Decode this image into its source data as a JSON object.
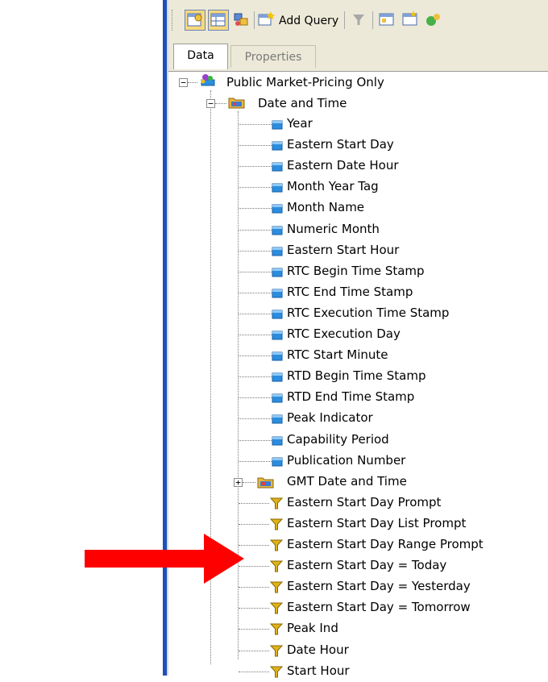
{
  "toolbar": {
    "add_query_label": "Add Query"
  },
  "tabs": [
    {
      "label": "Data",
      "active": true
    },
    {
      "label": "Properties",
      "active": false
    }
  ],
  "tree": {
    "root": {
      "label": "Public Market-Pricing Only",
      "expanded": true
    },
    "folder": {
      "label": "Date and Time",
      "expanded": true
    },
    "fields": [
      "Year",
      "Eastern Start Day",
      "Eastern Date Hour",
      "Month Year Tag",
      "Month Name",
      "Numeric Month",
      "Eastern Start Hour",
      "RTC Begin Time Stamp",
      "RTC End Time Stamp",
      "RTC Execution Time Stamp",
      "RTC Execution Day",
      "RTC Start Minute",
      "RTD Begin Time Stamp",
      "RTD End Time Stamp",
      "Peak Indicator",
      "Capability Period",
      "Publication Number"
    ],
    "subfolder": {
      "label": "GMT Date and Time",
      "expanded": false
    },
    "filters": [
      "Eastern Start Day Prompt",
      "Eastern Start Day List Prompt",
      "Eastern Start Day Range Prompt",
      "Eastern Start Day = Today",
      "Eastern Start Day = Yesterday",
      "Eastern Start Day = Tomorrow",
      "Peak Ind",
      "Date Hour",
      "Start Hour"
    ]
  },
  "colors": {
    "window_border": "#1f4fb8",
    "field_icon": "#2a8de0",
    "filter_icon": "#e0b21a",
    "arrow": "#ff0000"
  }
}
